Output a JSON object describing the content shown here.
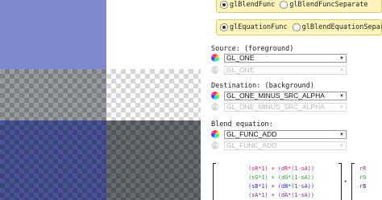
{
  "mode": {
    "func_options": [
      {
        "label": "glBlendFunc",
        "selected": true
      },
      {
        "label": "glBlendFuncSeparate",
        "selected": false
      }
    ],
    "equation_options": [
      {
        "label": "glEquationFunc",
        "selected": true
      },
      {
        "label": "glBlendEquationSeparate",
        "selected": false
      }
    ]
  },
  "source": {
    "label": "Source: (foreground)",
    "rgb_value": "GL_ONE",
    "alpha_value": "GL_ONE"
  },
  "destination": {
    "label": "Destination: (background)",
    "rgb_value": "GL_ONE_MINUS_SRC_ALPHA",
    "alpha_value": "GL_ONE_MINUS_SRC_ALPHA"
  },
  "equation": {
    "label": "Blend equation:",
    "rgb_value": "GL_FUNC_ADD",
    "alpha_value": "GL_FUNC_ADD"
  },
  "matrix": {
    "rows": [
      {
        "text": "(sR*1) + (dR*(1-sA))",
        "color": "#d0206a"
      },
      {
        "text": "(sG*1) + (dG*(1-sA))",
        "color": "#2a9a2a"
      },
      {
        "text": "(sB*1) + (dB*(1-sA))",
        "color": "#2030c0"
      },
      {
        "text": "(sA*1) + (dA*(1-sA))",
        "color": "#7a2a8a"
      }
    ],
    "operator": "*",
    "rhs": [
      {
        "text": "rR",
        "color": "#d0206a"
      },
      {
        "text": "rG",
        "color": "#2a9a2a"
      },
      {
        "text": "rB",
        "color": "#2030c0"
      }
    ]
  },
  "icons": {
    "color_picker": "color-wheel-icon",
    "disabled_picker": "color-wheel-disabled-icon"
  }
}
